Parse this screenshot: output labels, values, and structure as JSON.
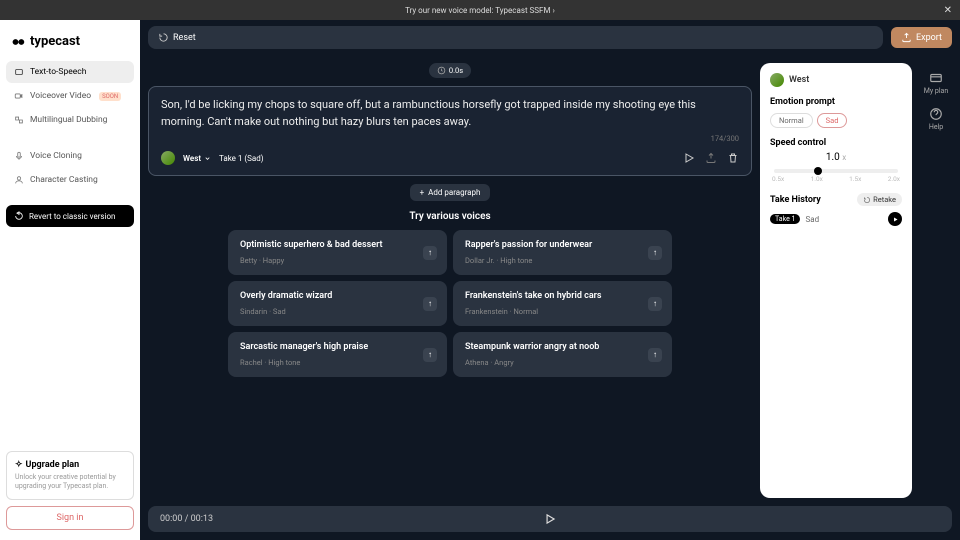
{
  "banner": {
    "text": "Try our new voice model: Typecast SSFM ›"
  },
  "brand": "typecast",
  "sidebar": {
    "items": [
      {
        "label": "Text-to-Speech"
      },
      {
        "label": "Voiceover Video",
        "badge": "SOON"
      },
      {
        "label": "Multilingual Dubbing"
      },
      {
        "label": "Voice Cloning"
      },
      {
        "label": "Character Casting"
      }
    ],
    "revert": "Revert to classic version",
    "upgrade": {
      "title": "Upgrade plan",
      "desc": "Unlock your creative potential by upgrading your Typecast plan."
    },
    "signin": "Sign in"
  },
  "topbar": {
    "reset": "Reset",
    "export": "Export"
  },
  "duration": "0.0s",
  "editor": {
    "text": "Son, I'd be licking my chops to square off, but a rambunctious horsefly got trapped inside my shooting eye this morning. Can't make out nothing but hazy blurs ten paces away.",
    "voice": "West",
    "take": "Take 1 (Sad)",
    "charcount": "174/300"
  },
  "addParagraph": "Add paragraph",
  "voicesTitle": "Try various voices",
  "voices": [
    {
      "title": "Optimistic superhero & bad dessert",
      "sub": "Betty · Happy"
    },
    {
      "title": "Rapper's passion for underwear",
      "sub": "Dollar Jr. · High tone"
    },
    {
      "title": "Overly dramatic wizard",
      "sub": "Sindarin · Sad"
    },
    {
      "title": "Frankenstein's take on hybrid cars",
      "sub": "Frankenstein · Normal"
    },
    {
      "title": "Sarcastic manager's high praise",
      "sub": "Rachel · High tone"
    },
    {
      "title": "Steampunk warrior angry at noob",
      "sub": "Athena · Angry"
    }
  ],
  "panel": {
    "voice": "West",
    "emotionTitle": "Emotion prompt",
    "emotions": [
      "Normal",
      "Sad"
    ],
    "activeEmotion": "Sad",
    "speedTitle": "Speed control",
    "speed": "1.0",
    "speedMarks": [
      "0.5x",
      "1.0x",
      "1.5x",
      "2.0x"
    ],
    "historyTitle": "Take History",
    "retake": "Retake",
    "history": [
      {
        "take": "Take 1",
        "emotion": "Sad"
      }
    ]
  },
  "rail": {
    "plan": "My plan",
    "help": "Help"
  },
  "player": {
    "time": "00:00 / 00:13"
  }
}
